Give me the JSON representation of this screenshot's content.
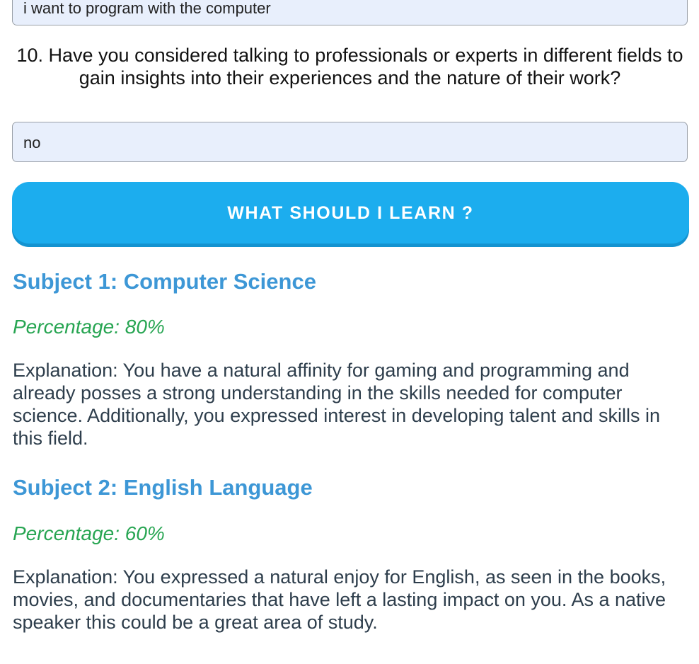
{
  "answer9": {
    "value": "i want to program with the computer"
  },
  "question10": {
    "text": "10. Have you considered talking to professionals or experts in different fields to gain insights into their experiences and the nature of their work?"
  },
  "answer10": {
    "value": "no"
  },
  "submit": {
    "label": "WHAT SHOULD I LEARN ?"
  },
  "results": [
    {
      "title": "Subject 1: Computer Science",
      "percentage": "Percentage: 80%",
      "explanation": "Explanation: You have a natural affinity for gaming and programming and already posses a strong understanding in the skills needed for computer science. Additionally, you expressed interest in developing talent and skills in this field."
    },
    {
      "title": "Subject 2: English Language",
      "percentage": "Percentage: 60%",
      "explanation": "Explanation: You expressed a natural enjoy for English, as seen in the books, movies, and documentaries that have left a lasting impact on you. As a native speaker this could be a great area of study."
    }
  ],
  "colors": {
    "button": "#1cadee",
    "subject_title": "#3d97d6",
    "percentage": "#27a552",
    "input_bg": "#e8effc"
  }
}
